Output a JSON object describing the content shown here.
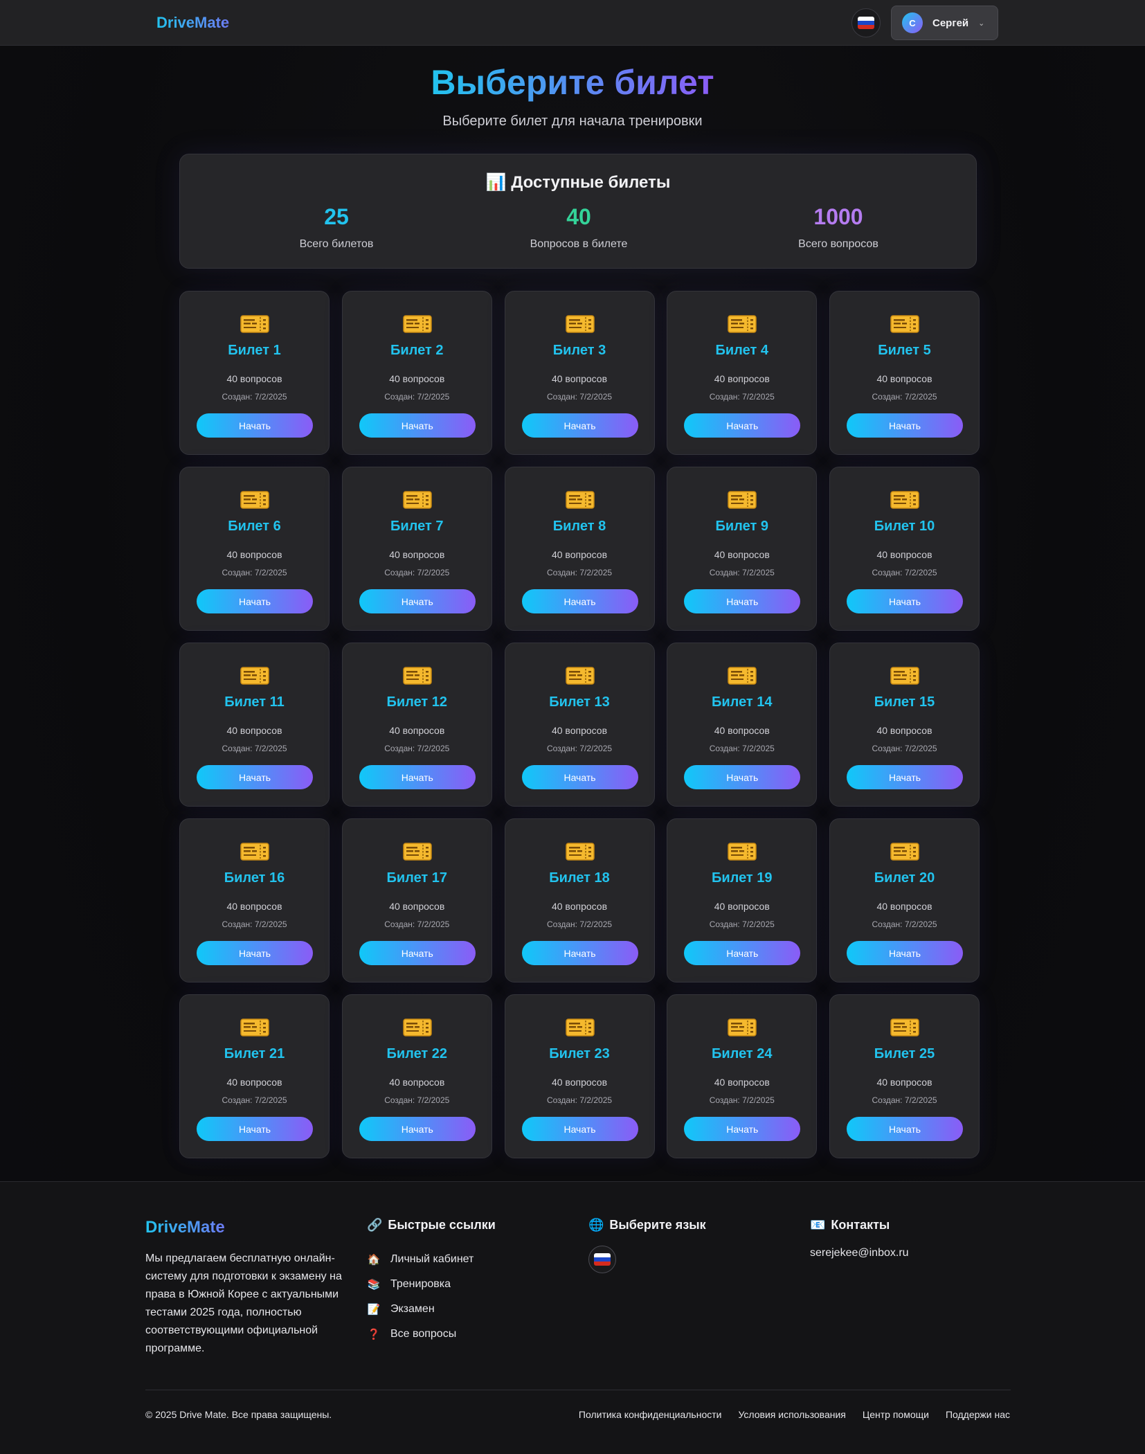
{
  "header": {
    "logo": "DriveMate",
    "user": {
      "initial": "С",
      "name": "Сергей"
    }
  },
  "page": {
    "title": "Выберите билет",
    "subtitle": "Выберите билет для начала тренировки"
  },
  "stats": {
    "title": "📊 Доступные билеты",
    "items": [
      {
        "value": "25",
        "label": "Всего билетов",
        "color": "#22c3ee"
      },
      {
        "value": "40",
        "label": "Вопросов в билете",
        "color": "#34d399"
      },
      {
        "value": "1000",
        "label": "Всего вопросов",
        "color": "#b57cf0"
      }
    ]
  },
  "tickets": [
    {
      "title": "Билет 1",
      "count": "40 вопросов",
      "created": "Создан: 7/2/2025",
      "button": "Начать"
    },
    {
      "title": "Билет 2",
      "count": "40 вопросов",
      "created": "Создан: 7/2/2025",
      "button": "Начать"
    },
    {
      "title": "Билет 3",
      "count": "40 вопросов",
      "created": "Создан: 7/2/2025",
      "button": "Начать"
    },
    {
      "title": "Билет 4",
      "count": "40 вопросов",
      "created": "Создан: 7/2/2025",
      "button": "Начать"
    },
    {
      "title": "Билет 5",
      "count": "40 вопросов",
      "created": "Создан: 7/2/2025",
      "button": "Начать"
    },
    {
      "title": "Билет 6",
      "count": "40 вопросов",
      "created": "Создан: 7/2/2025",
      "button": "Начать"
    },
    {
      "title": "Билет 7",
      "count": "40 вопросов",
      "created": "Создан: 7/2/2025",
      "button": "Начать"
    },
    {
      "title": "Билет 8",
      "count": "40 вопросов",
      "created": "Создан: 7/2/2025",
      "button": "Начать"
    },
    {
      "title": "Билет 9",
      "count": "40 вопросов",
      "created": "Создан: 7/2/2025",
      "button": "Начать"
    },
    {
      "title": "Билет 10",
      "count": "40 вопросов",
      "created": "Создан: 7/2/2025",
      "button": "Начать"
    },
    {
      "title": "Билет 11",
      "count": "40 вопросов",
      "created": "Создан: 7/2/2025",
      "button": "Начать"
    },
    {
      "title": "Билет 12",
      "count": "40 вопросов",
      "created": "Создан: 7/2/2025",
      "button": "Начать"
    },
    {
      "title": "Билет 13",
      "count": "40 вопросов",
      "created": "Создан: 7/2/2025",
      "button": "Начать"
    },
    {
      "title": "Билет 14",
      "count": "40 вопросов",
      "created": "Создан: 7/2/2025",
      "button": "Начать"
    },
    {
      "title": "Билет 15",
      "count": "40 вопросов",
      "created": "Создан: 7/2/2025",
      "button": "Начать"
    },
    {
      "title": "Билет 16",
      "count": "40 вопросов",
      "created": "Создан: 7/2/2025",
      "button": "Начать"
    },
    {
      "title": "Билет 17",
      "count": "40 вопросов",
      "created": "Создан: 7/2/2025",
      "button": "Начать"
    },
    {
      "title": "Билет 18",
      "count": "40 вопросов",
      "created": "Создан: 7/2/2025",
      "button": "Начать"
    },
    {
      "title": "Билет 19",
      "count": "40 вопросов",
      "created": "Создан: 7/2/2025",
      "button": "Начать"
    },
    {
      "title": "Билет 20",
      "count": "40 вопросов",
      "created": "Создан: 7/2/2025",
      "button": "Начать"
    },
    {
      "title": "Билет 21",
      "count": "40 вопросов",
      "created": "Создан: 7/2/2025",
      "button": "Начать"
    },
    {
      "title": "Билет 22",
      "count": "40 вопросов",
      "created": "Создан: 7/2/2025",
      "button": "Начать"
    },
    {
      "title": "Билет 23",
      "count": "40 вопросов",
      "created": "Создан: 7/2/2025",
      "button": "Начать"
    },
    {
      "title": "Билет 24",
      "count": "40 вопросов",
      "created": "Создан: 7/2/2025",
      "button": "Начать"
    },
    {
      "title": "Билет 25",
      "count": "40 вопросов",
      "created": "Создан: 7/2/2025",
      "button": "Начать"
    }
  ],
  "footer": {
    "logo": "DriveMate",
    "description": "Мы предлагаем бесплатную онлайн-систему для подготовки к экзамену на права в Южной Корее с актуальными тестами 2025 года, полностью соответствующими официальной программе.",
    "quick_links": {
      "title": "Быстрые ссылки",
      "icon": "🔗",
      "items": [
        {
          "icon": "🏠",
          "label": "Личный кабинет"
        },
        {
          "icon": "📚",
          "label": "Тренировка"
        },
        {
          "icon": "📝",
          "label": "Экзамен"
        },
        {
          "icon": "❓",
          "label": "Все вопросы"
        }
      ]
    },
    "language": {
      "title": "Выберите язык",
      "icon": "🌐"
    },
    "contacts": {
      "title": "Контакты",
      "icon": "📧",
      "email": "serejekee@inbox.ru"
    },
    "copyright": "© 2025 Drive Mate. Все права защищены.",
    "bottom_links": [
      "Политика конфиденциальности",
      "Условия использования",
      "Центр помощи",
      "Поддержи нас"
    ]
  },
  "colors": {
    "accent_cyan": "#22c3ee",
    "accent_violet": "#8b5cf6",
    "background": "#0b0b0d",
    "card": "#262629"
  }
}
